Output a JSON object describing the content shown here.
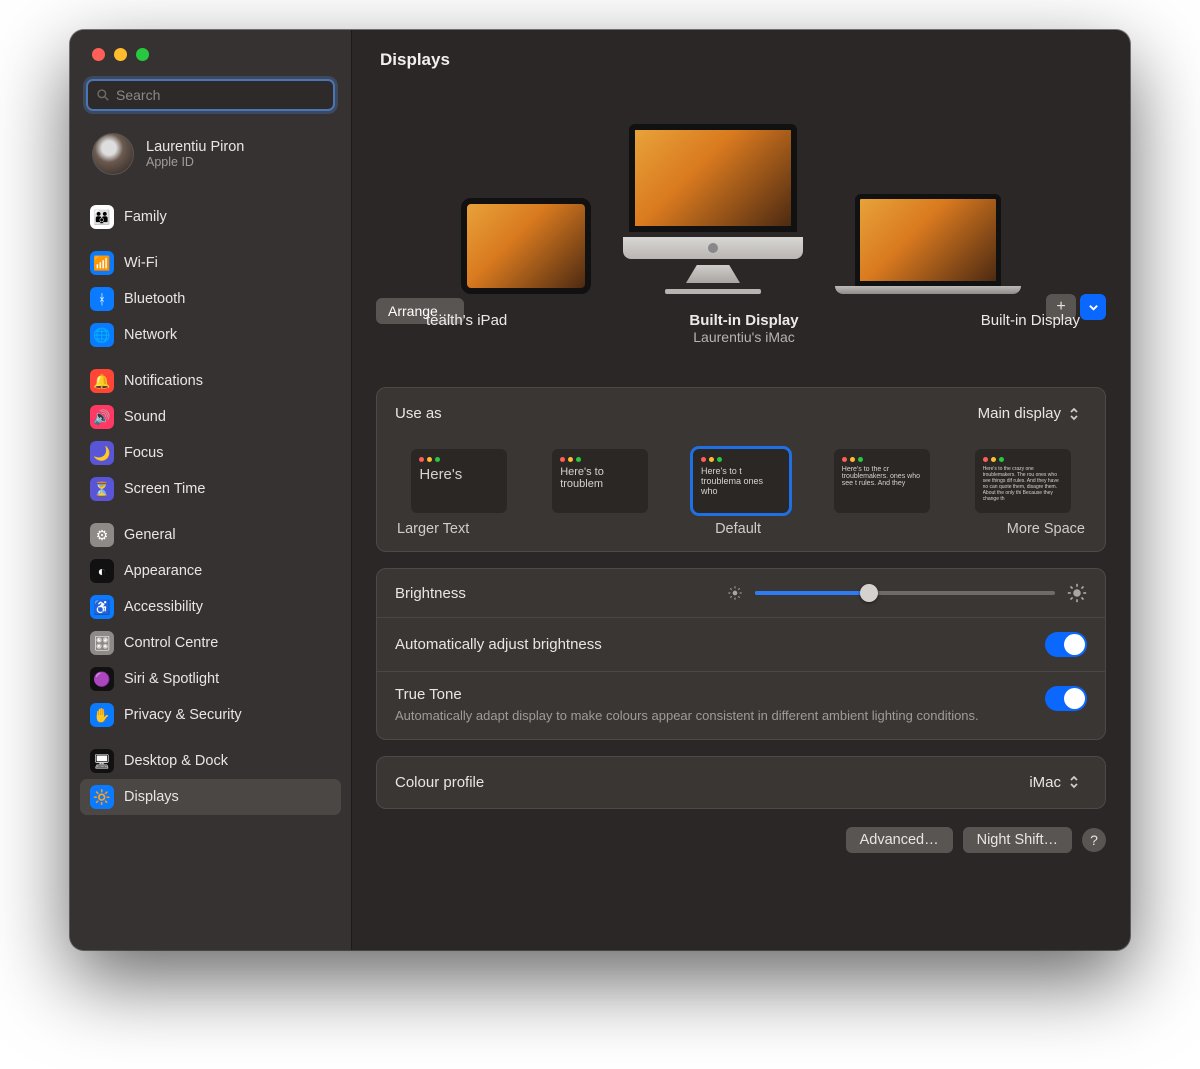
{
  "header": {
    "title": "Displays"
  },
  "search": {
    "placeholder": "Search"
  },
  "account": {
    "name": "Laurentiu Piron",
    "sub": "Apple ID"
  },
  "sidebar": {
    "groups": [
      {
        "items": [
          {
            "label": "Family",
            "color": "#ffffff"
          }
        ]
      },
      {
        "items": [
          {
            "label": "Wi-Fi",
            "color": "#0a7bff"
          },
          {
            "label": "Bluetooth",
            "color": "#0a7bff"
          },
          {
            "label": "Network",
            "color": "#0a7bff"
          }
        ]
      },
      {
        "items": [
          {
            "label": "Notifications",
            "color": "#ff4438"
          },
          {
            "label": "Sound",
            "color": "#ff3864"
          },
          {
            "label": "Focus",
            "color": "#5856d6"
          },
          {
            "label": "Screen Time",
            "color": "#5856d6"
          }
        ]
      },
      {
        "items": [
          {
            "label": "General",
            "color": "#8e8a87"
          },
          {
            "label": "Appearance",
            "color": "#111111"
          },
          {
            "label": "Accessibility",
            "color": "#0a7bff"
          },
          {
            "label": "Control Centre",
            "color": "#8e8a87"
          },
          {
            "label": "Siri & Spotlight",
            "color": "#111111"
          },
          {
            "label": "Privacy & Security",
            "color": "#0a7bff"
          }
        ]
      },
      {
        "items": [
          {
            "label": "Desktop & Dock",
            "color": "#111111"
          },
          {
            "label": "Displays",
            "color": "#0a7bff",
            "active": true
          }
        ]
      }
    ]
  },
  "displays": {
    "arrange": "Arrange…",
    "items": [
      {
        "title": "tealth's iPad",
        "sub": ""
      },
      {
        "title": "Built-in Display",
        "sub": "Laurentiu's iMac",
        "strong": true
      },
      {
        "title": "Built-in Display",
        "sub": ""
      }
    ]
  },
  "useas": {
    "label": "Use as",
    "value": "Main display"
  },
  "resolution": {
    "larger": "Larger Text",
    "default": "Default",
    "more": "More Space",
    "thumbs": [
      {
        "text": "Here's",
        "fs": "15px"
      },
      {
        "text": "Here's to troublem",
        "fs": "11px"
      },
      {
        "text": "Here's to t troublema ones who",
        "fs": "9px",
        "sel": true
      },
      {
        "text": "Here's to the cr troublemakers. ones who see t rules. And they",
        "fs": "7px"
      },
      {
        "text": "Here's to the crazy one troublemakers. The rou ones who see things dif rules. And they have no can quote them, disagre them. About the only thi Because they change th",
        "fs": "5px"
      }
    ]
  },
  "brightness": {
    "label": "Brightness",
    "value": 0.38
  },
  "autoBright": {
    "label": "Automatically adjust brightness",
    "on": true
  },
  "truetone": {
    "label": "True Tone",
    "desc": "Automatically adapt display to make colours appear consistent in different ambient lighting conditions.",
    "on": true
  },
  "colorprofile": {
    "label": "Colour profile",
    "value": "iMac"
  },
  "footer": {
    "advanced": "Advanced…",
    "nightshift": "Night Shift…"
  }
}
